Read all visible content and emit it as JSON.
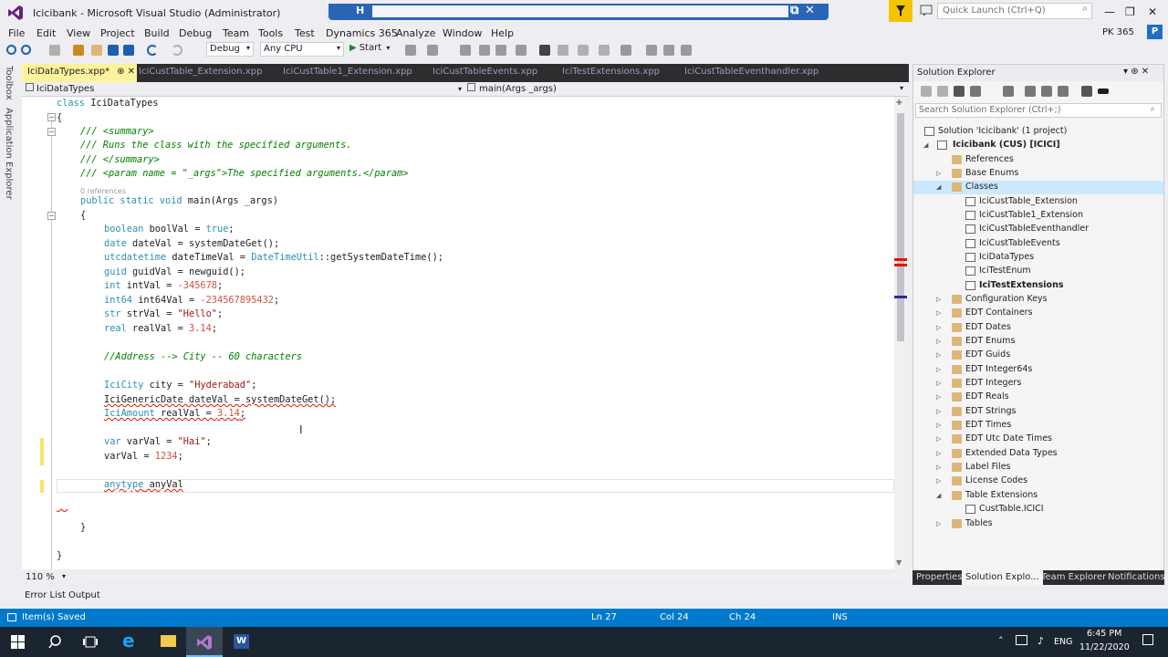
{
  "window": {
    "title": "Icicibank - Microsoft Visual Studio  (Administrator)",
    "quick_launch_placeholder": "Quick Launch (Ctrl+Q)",
    "remote_pin": "H",
    "remote_restore": "⧉",
    "remote_close": "✕",
    "minimize": "—",
    "maximize": "❐",
    "close": "✕"
  },
  "menu": [
    "File",
    "Edit",
    "View",
    "Project",
    "Build",
    "Debug",
    "Team",
    "Tools",
    "Test",
    "Dynamics 365",
    "Analyze",
    "Window",
    "Help"
  ],
  "account": {
    "name": "PK 365",
    "avatar": "P"
  },
  "toolbar": {
    "configuration": "Debug",
    "platform": "Any CPU",
    "start_label": "Start",
    "start_icon": "▶",
    "caret": "▾"
  },
  "left_strip": {
    "toolbox": "Toolbox",
    "app_explorer": "Application Explorer"
  },
  "doc_tabs": [
    {
      "label": "IciDataTypes.xpp*",
      "active": true,
      "pin": "⊕  ✕"
    },
    {
      "label": "IciCustTable_Extension.xpp"
    },
    {
      "label": "IciCustTable1_Extension.xpp"
    },
    {
      "label": "IciCustTableEvents.xpp"
    },
    {
      "label": "IciTestExtensions.xpp"
    },
    {
      "label": "IciCustTableEventhandler.xpp"
    }
  ],
  "navbar": {
    "class": "IciDataTypes",
    "member": "main(Args _args)"
  },
  "code": {
    "class_kw": "class",
    "class_name": " IciDataTypes",
    "open_brace": "{",
    "summary_open": "/// <summary>",
    "summary_text": "/// Runs the class with the specified arguments.",
    "summary_close": "/// </summary>",
    "param": "/// <param name = \"_args\">The specified arguments.</param>",
    "references": "0 references",
    "main_decl_kw": "public static void",
    "main_decl_rest": " main(Args _args)",
    "inner_open": "{",
    "l_bool_t": "boolean",
    "l_bool_rest": " boolVal = ",
    "l_bool_val": "true",
    "l_date_t": "date",
    "l_date_rest": " dateVal = systemDateGet();",
    "l_utc_t": "utcdatetime",
    "l_utc_rest": " dateTimeVal = ",
    "l_utc_cls": "DateTimeUtil",
    "l_utc_end": "::getSystemDateTime();",
    "l_guid_t": "guid",
    "l_guid_rest": " guidVal = newguid();",
    "l_int_t": "int",
    "l_int_rest": " intVal = ",
    "l_int_val": "-345678",
    "l_int64_t": "int64",
    "l_int64_rest": " int64Val = ",
    "l_int64_val": "-234567895432",
    "l_str_t": "str",
    "l_str_rest": " strVal = ",
    "l_str_val": "\"Hello\"",
    "l_real_t": "real",
    "l_real_rest": " realVal = ",
    "l_real_val": "3.14",
    "semi": ";",
    "comment_addr": "//Address --> City -- 60 characters",
    "l_city_t": "IciCity",
    "l_city_rest": " city = ",
    "l_city_val": "\"Hyderabad\"",
    "l_gdate": "IciGenericDate dateVal = systemDateGet();",
    "l_amt_t": "IciAmount",
    "l_amt_rest": " realVal = ",
    "l_amt_val": "3.14",
    "l_var_t": "var",
    "l_var_rest": " varVal = ",
    "l_var_val": "\"Hai\"",
    "l_varset": "varVal = ",
    "l_varset_val": "1234",
    "l_any_t": "anytype",
    "l_any_rest": " anyVal",
    "inner_close": "}",
    "outer_close": "}"
  },
  "zoom": "110 %",
  "solution_explorer": {
    "title": "Solution Explorer",
    "title_controls": "▾  ⊕  ✕",
    "search_placeholder": "Search Solution Explorer (Ctrl+;)",
    "items": [
      {
        "label": "Solution 'Icicibank' (1 project)",
        "icon": "solution-icon"
      },
      {
        "label": "Icicibank (CUS) [ICICI]",
        "icon": "project-icon",
        "bold": true
      },
      {
        "label": "References",
        "icon": "folder-icon"
      },
      {
        "label": "Base Enums",
        "icon": "folder-icon"
      },
      {
        "label": "Classes",
        "icon": "folder-icon",
        "selected": true
      },
      {
        "label": "IciCustTable_Extension",
        "icon": "class-icon"
      },
      {
        "label": "IciCustTable1_Extension",
        "icon": "class-icon"
      },
      {
        "label": "IciCustTableEventhandler",
        "icon": "class-icon"
      },
      {
        "label": "IciCustTableEvents",
        "icon": "class-icon"
      },
      {
        "label": "IciDataTypes",
        "icon": "class-icon"
      },
      {
        "label": "IciTestEnum",
        "icon": "class-icon"
      },
      {
        "label": "IciTestExtensions",
        "icon": "class-icon",
        "bold": true
      },
      {
        "label": "Configuration Keys",
        "icon": "folder-icon"
      },
      {
        "label": "EDT Containers",
        "icon": "folder-icon"
      },
      {
        "label": "EDT Dates",
        "icon": "folder-icon"
      },
      {
        "label": "EDT Enums",
        "icon": "folder-icon"
      },
      {
        "label": "EDT Guids",
        "icon": "folder-icon"
      },
      {
        "label": "EDT Integer64s",
        "icon": "folder-icon"
      },
      {
        "label": "EDT Integers",
        "icon": "folder-icon"
      },
      {
        "label": "EDT Reals",
        "icon": "folder-icon"
      },
      {
        "label": "EDT Strings",
        "icon": "folder-icon"
      },
      {
        "label": "EDT Times",
        "icon": "folder-icon"
      },
      {
        "label": "EDT Utc Date Times",
        "icon": "folder-icon"
      },
      {
        "label": "Extended Data Types",
        "icon": "folder-icon"
      },
      {
        "label": "Label Files",
        "icon": "folder-icon"
      },
      {
        "label": "License Codes",
        "icon": "folder-icon"
      },
      {
        "label": "Table Extensions",
        "icon": "folder-icon"
      },
      {
        "label": "CustTable.ICICI",
        "icon": "table-icon"
      },
      {
        "label": "Tables",
        "icon": "folder-icon"
      }
    ]
  },
  "se_tabs": [
    "Properties",
    "Solution Explo...",
    "Team Explorer",
    "Notifications"
  ],
  "bottom_tabs": [
    "Error List",
    "Output"
  ],
  "status": {
    "message": "Item(s) Saved",
    "line": "Ln 27",
    "col": "Col 24",
    "ch": "Ch 24",
    "mode": "INS"
  },
  "taskbar": {
    "lang": "ENG",
    "time": "6:45 PM",
    "date": "11/22/2020"
  },
  "colors": {
    "accent": "#007acc",
    "active_tab": "#fff29d",
    "keyword": "#2b91af",
    "comment": "#008000",
    "string": "#a31515",
    "number": "#d2513b"
  }
}
